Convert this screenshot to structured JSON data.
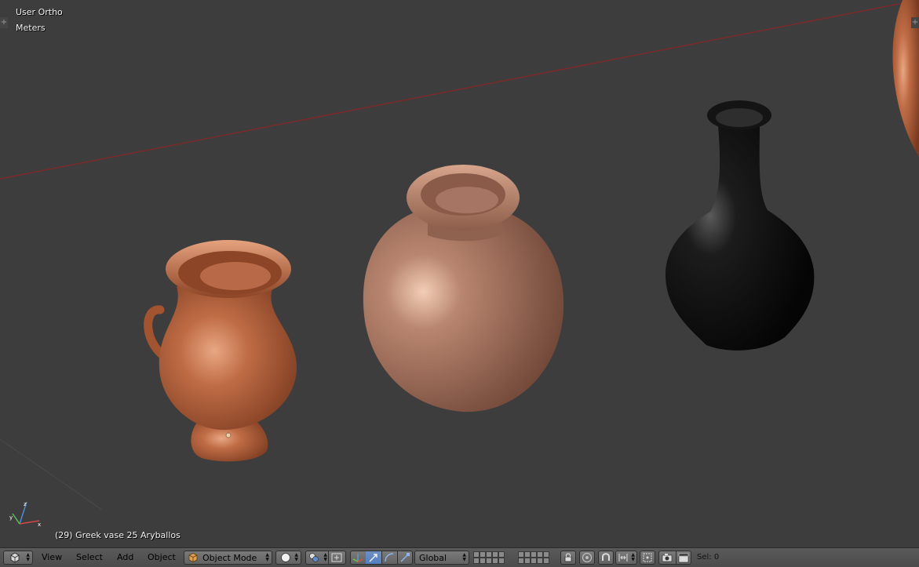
{
  "viewport": {
    "view_name": "User Ortho",
    "units": "Meters",
    "active_object": "(29) Greek vase 25 Aryballos",
    "background_color": "#3d3d3d",
    "x_axis_color": "#7a2a2a"
  },
  "header": {
    "editor_type_icon": "3d-view-cube-icon",
    "menus": [
      "View",
      "Select",
      "Add",
      "Object"
    ],
    "mode": {
      "label": "Object Mode",
      "icon": "cube-icon"
    },
    "shading_icon": "solid-sphere-icon",
    "pivot_icon": "pivot-point-icon",
    "transform_orientation": "Global",
    "selection_count": "Sel: 0"
  },
  "colors": {
    "header_bg": "#4e4e4e",
    "active_button": "#5680c2",
    "terracotta": "#b86a48",
    "clay": "#a87460",
    "black_glaze": "#111111"
  }
}
